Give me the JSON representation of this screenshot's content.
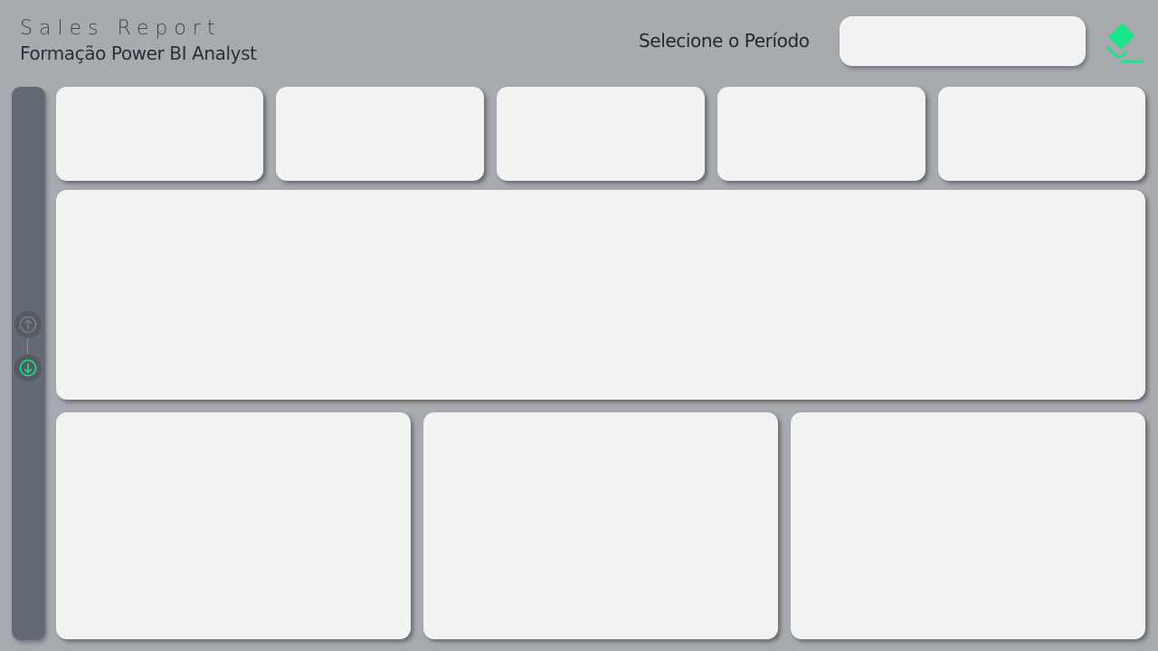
{
  "header": {
    "title": "Sales Report",
    "subtitle": "Formação Power BI Analyst"
  },
  "filter": {
    "label": "Selecione o Período",
    "selected_value": ""
  },
  "actions": {
    "clear_filters_icon": "eraser-icon",
    "accent_color": "#19e68a"
  },
  "sidebar": {
    "nav_up_icon": "arrow-up-circle-icon",
    "nav_down_icon": "arrow-down-circle-icon",
    "color": "#646a75"
  },
  "colors": {
    "background": "#a7aaae",
    "card": "#f2f2f2",
    "inactive_icon": "#7c8189"
  }
}
